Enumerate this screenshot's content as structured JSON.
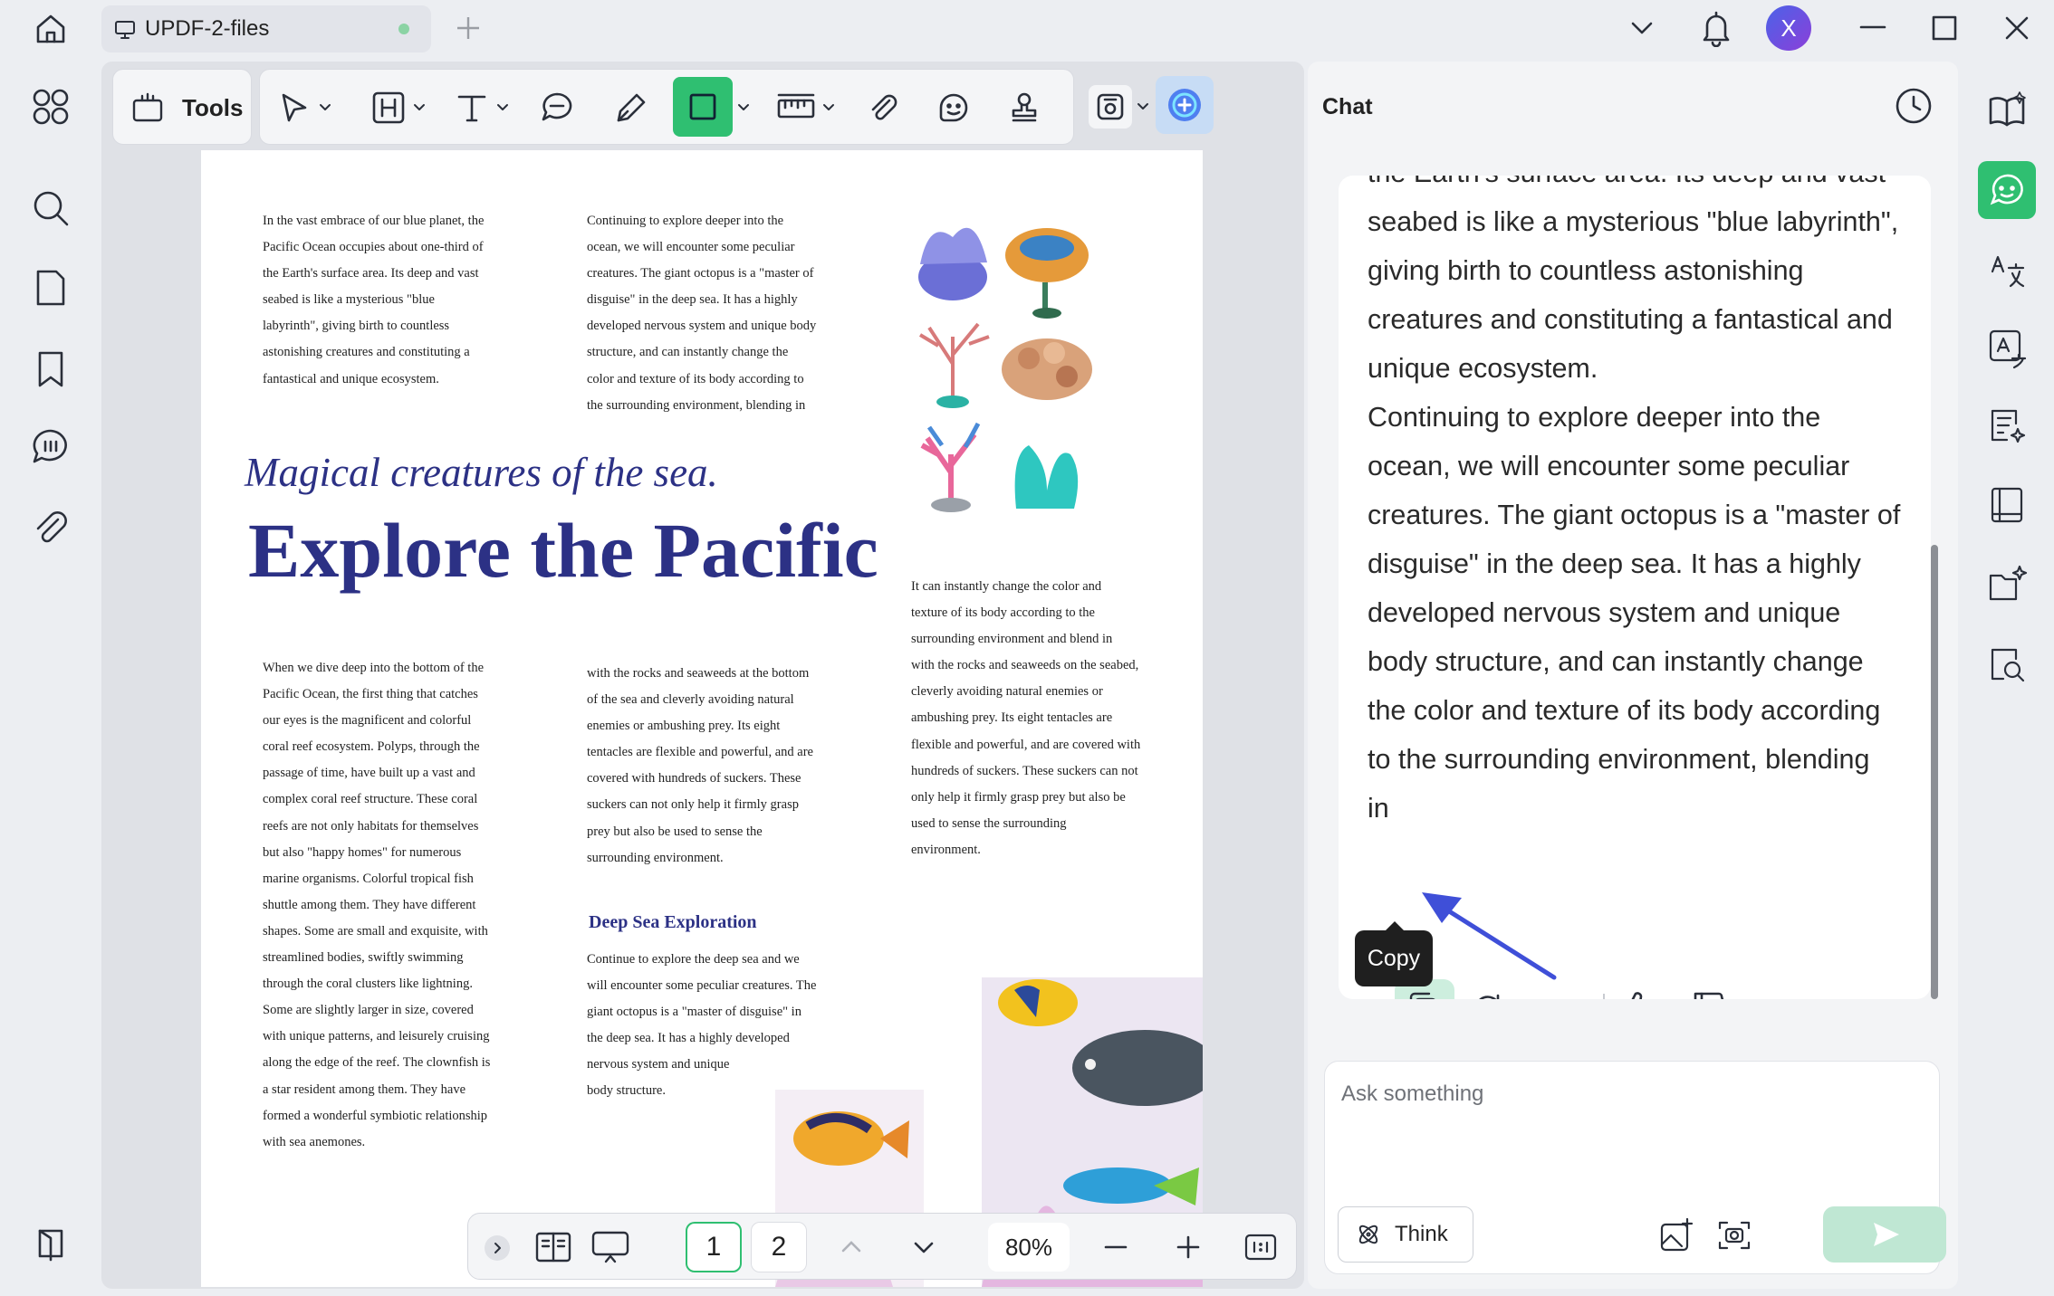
{
  "window": {
    "tab_title": "UPDF-2-files",
    "account_initial": "X"
  },
  "toolbar": {
    "tools_label": "Tools"
  },
  "document": {
    "col1_top": "In the vast embrace of our blue planet, the\nPacific Ocean occupies about one-third of\nthe Earth's surface area. Its deep and vast\nseabed is like a mysterious \"blue\nlabyrinth\", giving birth to countless\nastonishing creatures and constituting a\nfantastical and unique ecosystem.",
    "col2_top": "Continuing to explore deeper into the\nocean, we will encounter some peculiar\ncreatures. The giant octopus is a \"master of\ndisguise\" in the deep sea. It has a highly\ndeveloped nervous system and unique body\nstructure, and can instantly change the\ncolor and texture of its body according to\nthe surrounding environment, blending in",
    "subtitle": "Magical creatures of the sea.",
    "title": "Explore the Pacific",
    "col3_mid": "It can instantly change the color and\ntexture of its body according to the\nsurrounding environment and blend in\nwith the rocks and seaweeds on the seabed,\ncleverly avoiding natural enemies or\nambushing prey. Its eight tentacles are\nflexible and powerful, and are covered with\nhundreds of suckers. These suckers can not\nonly help it firmly grasp prey but also be\nused to sense the surrounding\nenvironment.",
    "col1_bottom": "When we dive deep into the bottom of the\nPacific Ocean, the first thing that catches\nour eyes is the magnificent and colorful\ncoral reef ecosystem. Polyps, through the\npassage of time, have built up a vast and\ncomplex coral reef structure. These coral\nreefs are not only habitats for themselves\nbut also \"happy homes\" for numerous\nmarine organisms. Colorful tropical fish\nshuttle among them. They have different\nshapes. Some are small and exquisite, with\nstreamlined bodies, swiftly swimming\nthrough the coral clusters like lightning.\nSome are slightly larger in size, covered\nwith unique patterns, and leisurely cruising\nalong the edge of the reef. The clownfish is\na star resident among them. They have\nformed a wonderful symbiotic relationship\nwith sea anemones.",
    "col2_bottom": "with the rocks and seaweeds at the bottom\nof the sea and cleverly avoiding natural\nenemies or ambushing prey. Its eight\ntentacles are flexible and powerful, and are\ncovered with hundreds of suckers. These\nsuckers can not only help it firmly grasp\nprey but also be used to sense the\nsurrounding environment.",
    "section_heading": "Deep Sea Exploration",
    "section_body": "Continue to explore the deep sea and we\nwill encounter some peculiar creatures. The\ngiant octopus is a \"master of disguise\" in\nthe deep sea. It has a highly developed\nnervous system and unique\nbody structure."
  },
  "bottombar": {
    "page1": "1",
    "page2": "2",
    "zoom": "80%"
  },
  "chat": {
    "title": "Chat",
    "message": "the Earth's surface area. Its deep and vast\nseabed is like a mysterious \"blue labyrinth\",\ngiving birth to countless astonishing\ncreatures and constituting a fantastical and\nunique ecosystem.\nContinuing to explore deeper into the\nocean, we will encounter some peculiar\ncreatures. The giant octopus is a \"master of\ndisguise\" in the deep sea. It has a highly\ndeveloped nervous system and unique\nbody structure, and can instantly change\nthe color and texture of its body according\nto the surrounding environment, blending\nin",
    "tooltip": "Copy",
    "input_placeholder": "Ask something",
    "think_label": "Think"
  },
  "colors": {
    "accent_green": "#2fbf71",
    "title_blue": "#2c3185",
    "arrow": "#3f4fd8"
  }
}
